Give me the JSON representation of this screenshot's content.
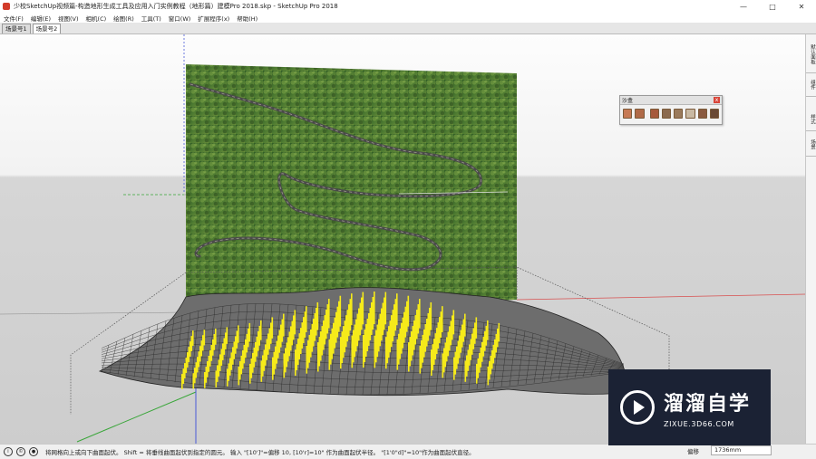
{
  "window": {
    "title": "少校SketchUp视频篇-构造地形生成工具及应用入门实例教程（地形篇）建模Pro 2018.skp - SketchUp Pro 2018",
    "minimize": "—",
    "maximize": "□",
    "close": "✕"
  },
  "menu": [
    "文件(F)",
    "编辑(E)",
    "视图(V)",
    "相机(C)",
    "绘图(R)",
    "工具(T)",
    "窗口(W)",
    "扩展程序(x)",
    "帮助(H)"
  ],
  "scene_tabs": [
    "场景号1",
    "场景号2"
  ],
  "active_scene_tab": 1,
  "sandbox_toolbar": {
    "title": "沙盒",
    "close": "x",
    "tools": [
      {
        "name": "from-contours-icon",
        "color": "#c77a55"
      },
      {
        "name": "from-scratch-icon",
        "color": "#b06a48"
      },
      {
        "name": "smoove-icon",
        "color": "#a65a3c"
      },
      {
        "name": "stamp-icon",
        "color": "#8b6a4f"
      },
      {
        "name": "drape-icon",
        "color": "#9a7a5c"
      },
      {
        "name": "add-detail-icon",
        "color": "#c9b9a3"
      },
      {
        "name": "flip-edge-icon",
        "color": "#8a5a40"
      },
      {
        "name": "terrain-icon",
        "color": "#6b4a35"
      }
    ]
  },
  "right_panel": [
    "默认面板",
    "组件",
    "样式",
    "场景"
  ],
  "status": {
    "text": "将网格向上或向下曲面起伏。 Shift = 将垂线曲面起伏到指定的圆元。 输入 \"[10']\"=偏移 10, [10'r]=10\" 作为曲面起伏半径。 \"[1'0\"d]\"=10\"作为曲面起伏直径。",
    "measure_label": "偏移",
    "measure_value": "1736mm"
  },
  "watermark": {
    "brand": "溜溜自学",
    "url": "ZIXUE.3D66.COM"
  },
  "colors": {
    "terrain_mesh": "#2a2a2a",
    "selected_vertices": "#f5ea1a",
    "red_axis": "#d85050",
    "green_axis": "#3aa63a",
    "blue_axis": "#4a5ad8"
  }
}
